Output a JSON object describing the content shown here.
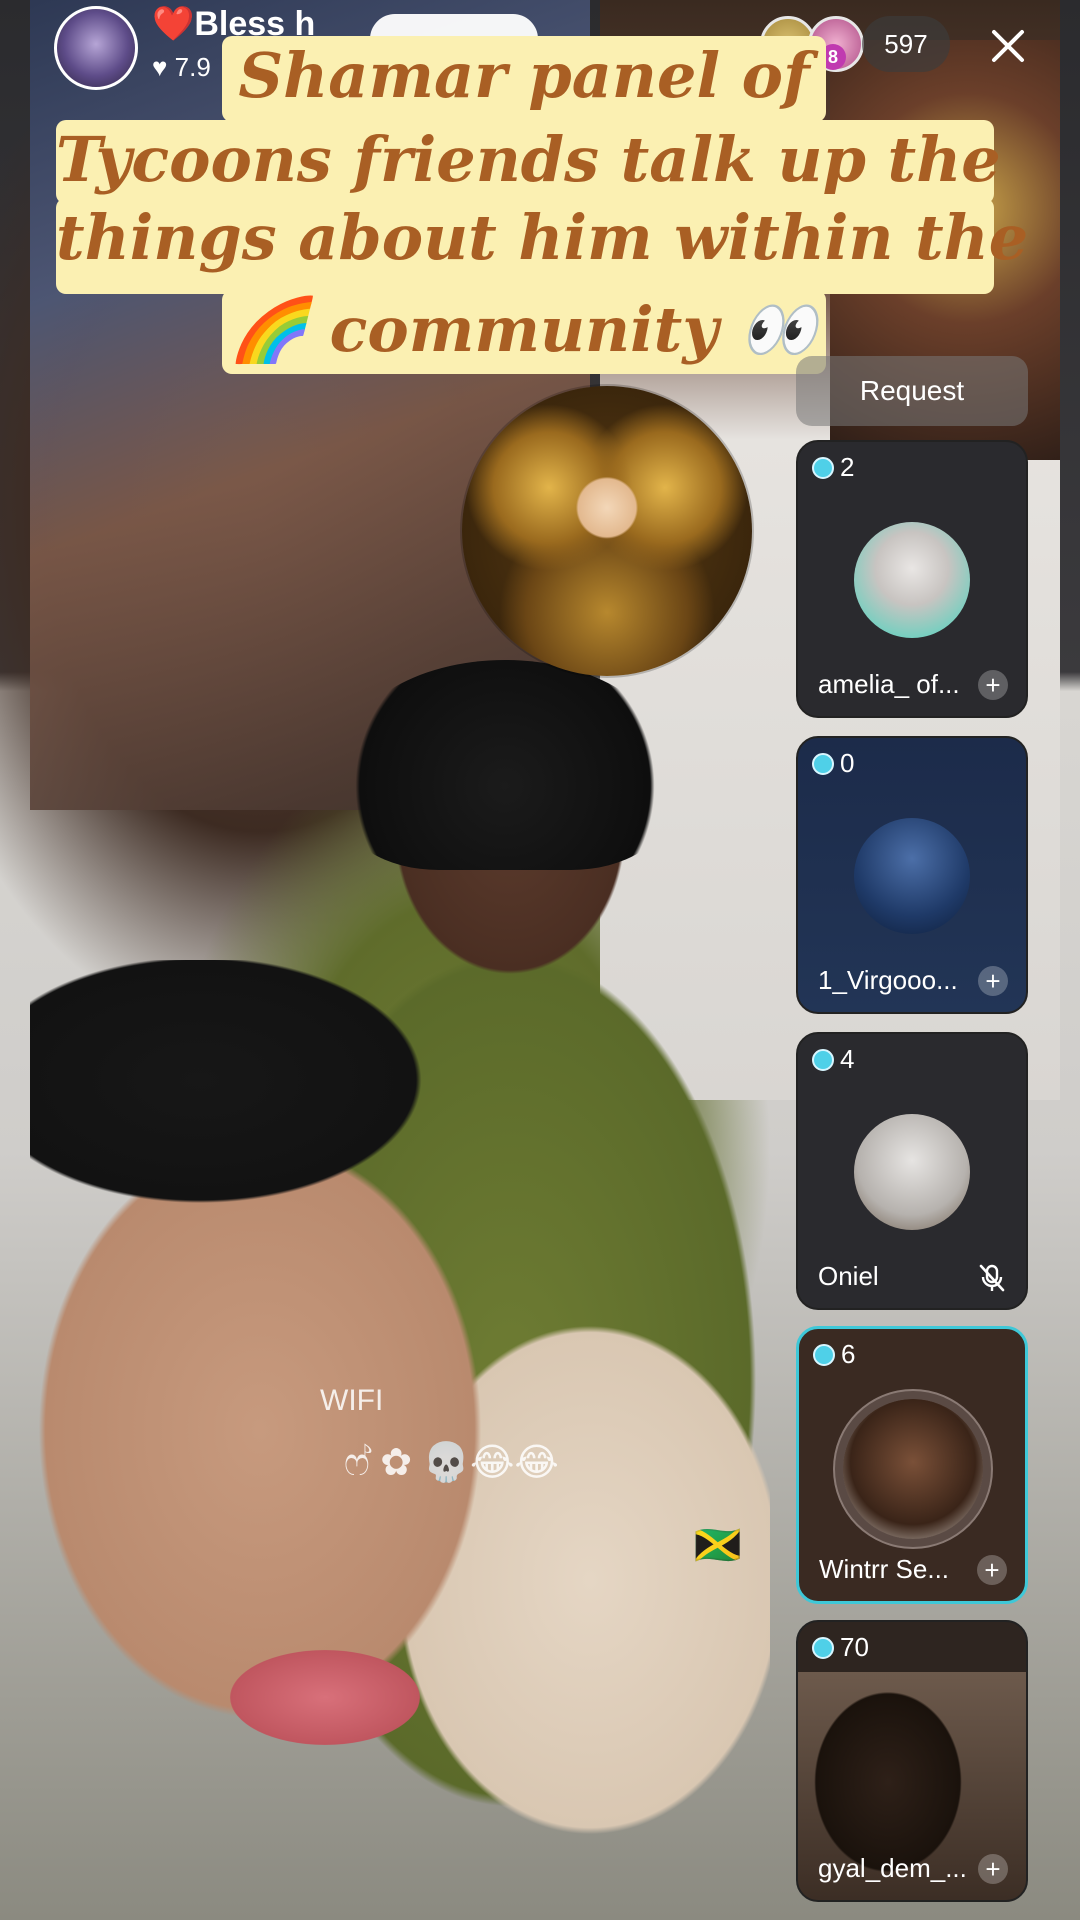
{
  "host": {
    "name": "Bless h",
    "likes": "7.9",
    "viewer_count": "597",
    "viewer_badge": "8"
  },
  "caption": {
    "line1": "Shamar panel of",
    "line2": "Tycoons friends talk up the",
    "line3": "things about him within the",
    "line4": "🌈 community 👀"
  },
  "overlay_stream_text": {
    "wifi": "WIFI",
    "emojis": "ෆ් ✿ 💀😂😂",
    "flag": "🇯🇲"
  },
  "request_label": "Request",
  "guests": [
    {
      "count": "2",
      "name": "amelia_ of...",
      "action": "+"
    },
    {
      "count": "0",
      "name": "1_Virgooo...",
      "action": "+"
    },
    {
      "count": "4",
      "name": "Oniel",
      "action": "mic-muted-icon"
    },
    {
      "count": "6",
      "name": "Wintrr Se...",
      "action": "+"
    },
    {
      "count": "70",
      "name": "gyal_dem_...",
      "action": "+"
    }
  ],
  "colors": {
    "caption_bg": "#fbf0b2",
    "caption_text": "#a95f24",
    "active_border": "#3ec8d8",
    "gem": "#4fd0e8"
  }
}
